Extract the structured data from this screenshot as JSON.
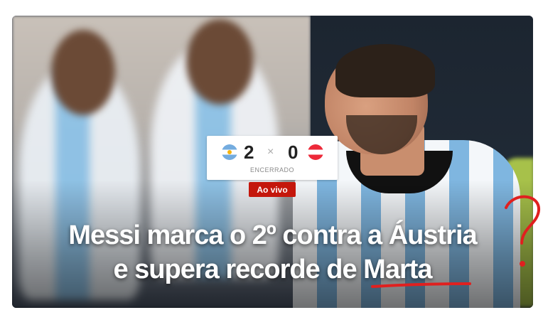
{
  "match": {
    "home": {
      "team_flag": "argentina-flag-icon",
      "goals": "2"
    },
    "separator": "×",
    "away": {
      "team_flag": "austria-flag-icon",
      "goals": "0"
    },
    "status": "ENCERRADO"
  },
  "live_badge": "Ao vivo",
  "headline": {
    "line1": "Messi marca o 2º contra a Áustria",
    "line2": "e supera recorde de Marta"
  },
  "annotations": {
    "mark": "?"
  },
  "colors": {
    "live_badge": "#c4170c",
    "annotation": "#e0201f",
    "headline_text": "#ffffff"
  }
}
